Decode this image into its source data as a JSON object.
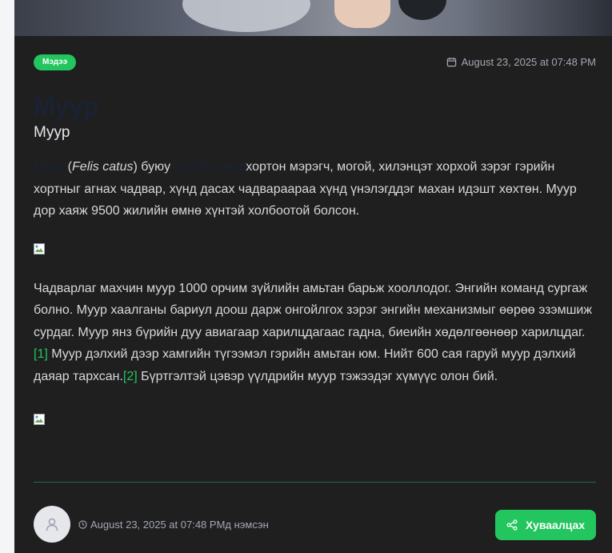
{
  "article": {
    "category": "Мэдээ",
    "published": "August 23, 2025 at 07:48 PM",
    "title": "Муур",
    "subtitle": "Муур",
    "paragraph1": {
      "link1": "Муур",
      "open_paren": " (",
      "latin": "Felis catus",
      "after_latin": ") буюу ",
      "link2": "гэрийн муур",
      "rest": "хортон мэрэгч, могой, хилэнцэт хорхой зэрэг гэрийн хортныг агнах чадвар, хүнд дасах чадвараараа хүнд үнэлэгддэг махан идэшт хөхтөн. Муур дор хаяж 9500 жилийн өмнө хүнтэй холбоотой болсон."
    },
    "paragraph2": {
      "text1": "Чадварлаг махчин муур 1000 орчим зүйлийн амьтан барьж хооллодог. Энгийн команд сургаж болно. Муур хаалганы бариул доош дарж онгойлгох зэрэг энгийн механизмыг өөрөө эзэмшиж сурдаг. Муур янз бүрийн дуу авиагаар харилцдагаас гадна, биеийн хөдөлгөөнөөр харилцдаг.",
      "ref1": "[1]",
      "text2": " Муур дэлхий дээр хамгийн түгээмэл гэрийн амьтан юм. Нийт 600 сая гаруй муур дэлхий даяар тархсан.",
      "ref2": "[2]",
      "text3": " Бүртгэлтэй цэвэр үүлдрийн муур тэжээдэг хүмүүс олон бий."
    }
  },
  "footer": {
    "added": "August 23, 2025 at 07:48 PMд нэмсэн",
    "share_label": "Хуваалцах"
  },
  "colors": {
    "accent": "#22c55e",
    "background": "#1f1f1f",
    "text": "#d6d8dc",
    "muted": "#a3a8b2"
  },
  "icons": [
    "calendar-icon",
    "clock-icon",
    "user-icon",
    "share-icon",
    "broken-image-icon"
  ]
}
